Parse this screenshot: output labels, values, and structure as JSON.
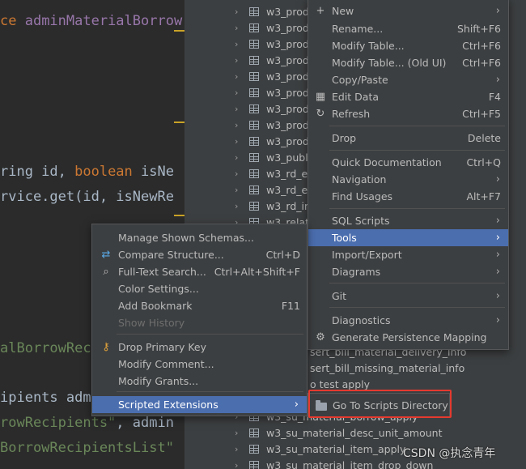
{
  "editor": {
    "lines": [
      {
        "parts": [
          {
            "t": "ce ",
            "c": "kw"
          },
          {
            "t": "adminMaterialBorrow",
            "c": "cls"
          }
        ]
      },
      {
        "parts": [
          {
            "t": "ring id, ",
            "c": ""
          },
          {
            "t": "boolean ",
            "c": "kw"
          },
          {
            "t": "isNe",
            "c": ""
          }
        ]
      },
      {
        "parts": [
          {
            "t": "rvice.get(id, isNewRe",
            "c": ""
          }
        ]
      },
      {
        "parts": [
          {
            "t": "alBorrowRec",
            "c": "str"
          }
        ]
      },
      {
        "parts": [
          {
            "t": "ipients admi",
            "c": ""
          }
        ]
      },
      {
        "parts": [
          {
            "t": "rowRecipients\"",
            "c": "str"
          },
          {
            "t": ", admin",
            "c": ""
          }
        ]
      },
      {
        "parts": [
          {
            "t": "BorrowRecipientsList\"",
            "c": "str"
          }
        ]
      }
    ]
  },
  "tree": {
    "rows": [
      {
        "label": "w3_prod"
      },
      {
        "label": "w3_prod"
      },
      {
        "label": "w3_prod"
      },
      {
        "label": "w3_prod"
      },
      {
        "label": "w3_prod"
      },
      {
        "label": "w3_prod"
      },
      {
        "label": "w3_prod"
      },
      {
        "label": "w3_prod"
      },
      {
        "label": "w3_prod"
      },
      {
        "label": "w3_publ"
      },
      {
        "label": "w3_rd_er"
      },
      {
        "label": "w3_rd_er"
      },
      {
        "label": "w3_rd_in"
      },
      {
        "label": "w3_relat"
      }
    ],
    "tail_rows": [
      {
        "label": "sert_bill_material_delivery_info"
      },
      {
        "label": "sert_bill_missing_material_info"
      },
      {
        "label": "o test apply"
      }
    ],
    "bottom_rows": [
      {
        "label": "w3_su_material_borrow_apply"
      },
      {
        "label": "w3_su_material_desc_unit_amount"
      },
      {
        "label": "w3_su_material_item_apply"
      },
      {
        "label": "w3_su_material_item_drop_down"
      }
    ]
  },
  "main_menu": {
    "items": [
      {
        "label": "New",
        "shortcut": "",
        "submenu": true,
        "icon": "plus-icon"
      },
      {
        "label": "Rename...",
        "shortcut": "Shift+F6"
      },
      {
        "label": "Modify Table...",
        "shortcut": "Ctrl+F6"
      },
      {
        "label": "Modify Table... (Old UI)",
        "shortcut": "Ctrl+F6"
      },
      {
        "label": "Copy/Paste",
        "shortcut": "",
        "submenu": true
      },
      {
        "label": "Edit Data",
        "shortcut": "F4",
        "icon": "table-icon"
      },
      {
        "label": "Refresh",
        "shortcut": "Ctrl+F5",
        "icon": "refresh-icon"
      },
      {
        "label": "Drop",
        "shortcut": "Delete"
      },
      {
        "label": "Quick Documentation",
        "shortcut": "Ctrl+Q"
      },
      {
        "label": "Navigation",
        "shortcut": "",
        "submenu": true
      },
      {
        "label": "Find Usages",
        "shortcut": "Alt+F7"
      },
      {
        "label": "SQL Scripts",
        "shortcut": "",
        "submenu": true
      },
      {
        "label": "Tools",
        "shortcut": "",
        "submenu": true,
        "selected": true
      },
      {
        "label": "Import/Export",
        "shortcut": "",
        "submenu": true
      },
      {
        "label": "Diagrams",
        "shortcut": "",
        "submenu": true
      },
      {
        "label": "Git",
        "shortcut": "",
        "submenu": true
      },
      {
        "label": "Diagnostics",
        "shortcut": "",
        "submenu": true
      },
      {
        "label": "Generate Persistence Mapping",
        "shortcut": "",
        "icon": "persistence-icon"
      }
    ]
  },
  "tools_menu": {
    "items": [
      {
        "label": "Manage Shown Schemas...",
        "shortcut": ""
      },
      {
        "label": "Compare Structure...",
        "shortcut": "Ctrl+D",
        "icon": "compare-icon"
      },
      {
        "label": "Full-Text Search...",
        "shortcut": "Ctrl+Alt+Shift+F",
        "icon": "search-icon"
      },
      {
        "label": "Color Settings...",
        "shortcut": ""
      },
      {
        "label": "Add Bookmark",
        "shortcut": "F11"
      },
      {
        "label": "Show History",
        "shortcut": "",
        "disabled": true
      },
      {
        "label": "Drop Primary Key",
        "shortcut": "",
        "icon": "key-icon"
      },
      {
        "label": "Modify Comment...",
        "shortcut": ""
      },
      {
        "label": "Modify Grants...",
        "shortcut": ""
      },
      {
        "label": "Scripted Extensions",
        "shortcut": "",
        "submenu": true,
        "selected": true
      }
    ]
  },
  "scripts_menu": {
    "item_label": "Go To Scripts Directory",
    "icon": "folder-icon"
  },
  "watermark": "CSDN @执念青年",
  "colors": {
    "selection": "#4b6eaf",
    "highlight_border": "#e53a2f",
    "menu_bg": "#3c3f41"
  }
}
